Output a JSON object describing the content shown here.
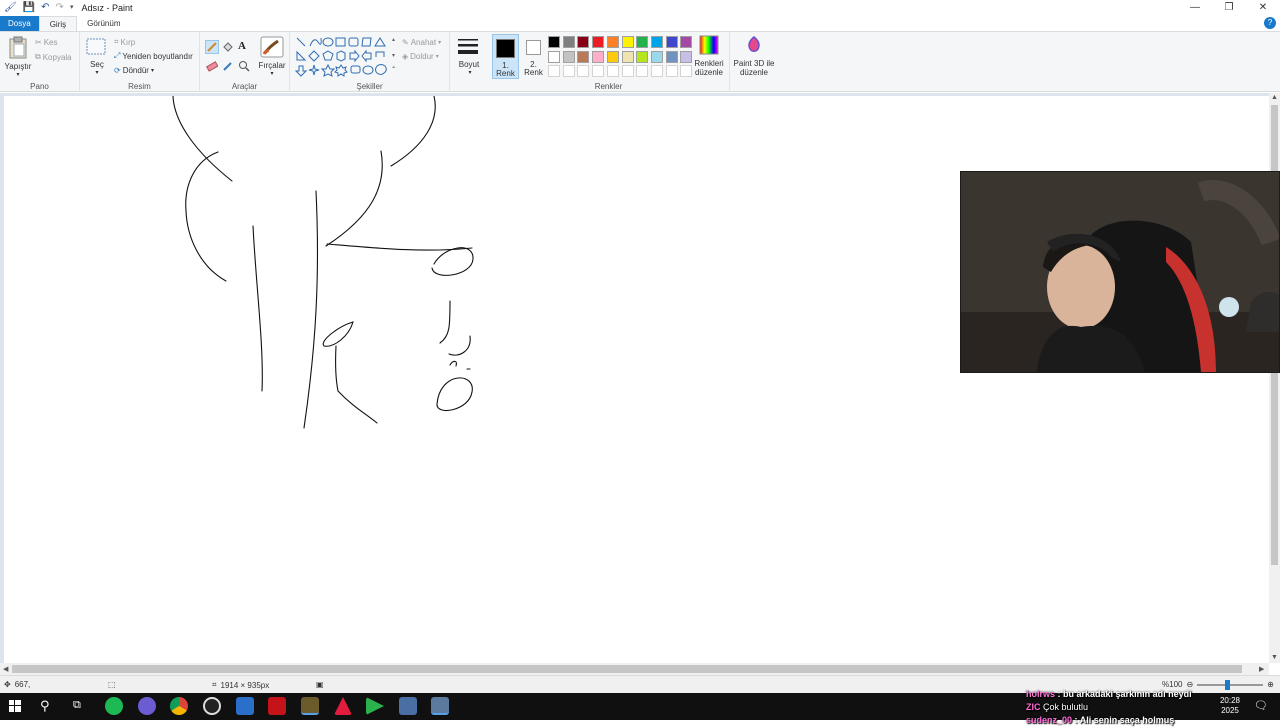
{
  "window": {
    "title": "Adsız - Paint"
  },
  "tabs": [
    {
      "label": "Dosya"
    },
    {
      "label": "Giriş"
    },
    {
      "label": "Görünüm"
    }
  ],
  "ribbon": {
    "clipboard": {
      "paste_label": "Yapıştır",
      "cut_label": "Kes",
      "copy_label": "Kopyala",
      "group_label": "Pano"
    },
    "image": {
      "select_label": "Seç",
      "crop_label": "Kırp",
      "resize_label": "Yeniden boyutlandır",
      "rotate_label": "Döndür",
      "group_label": "Resim"
    },
    "tools": {
      "group_label": "Araçlar",
      "brushes_label": "Fırçalar"
    },
    "shapes": {
      "outline_label": "Anahat",
      "fill_label": "Doldur",
      "group_label": "Şekiller"
    },
    "size": {
      "label": "Boyut"
    },
    "colors": {
      "color1_label_line1": "1.",
      "color1_label_line2": "Renk",
      "color2_label_line1": "2.",
      "color2_label_line2": "Renk",
      "color1_value": "#000000",
      "color2_value": "#ffffff",
      "edit_colors_line1": "Renkleri",
      "edit_colors_line2": "düzenle",
      "paint3d_line1": "Paint 3D ile",
      "paint3d_line2": "düzenle",
      "group_label": "Renkler",
      "palette_row1": [
        "#000000",
        "#7f7f7f",
        "#880015",
        "#ed1c24",
        "#ff7f27",
        "#fff200",
        "#22b14c",
        "#00a2e8",
        "#3f48cc",
        "#a349a4"
      ],
      "palette_row2": [
        "#ffffff",
        "#c3c3c3",
        "#b97a57",
        "#ffaec9",
        "#ffc90e",
        "#efe4b0",
        "#b5e61d",
        "#99d9ea",
        "#7092be",
        "#c8bfe7"
      ]
    }
  },
  "status": {
    "cursor_pos": "667,",
    "canvas_size": "1914 × 935px",
    "zoom": "%100"
  },
  "taskbar": {
    "time": "20:28",
    "date": "2025"
  },
  "chat": [
    {
      "user": "holrws",
      "message": ": bu arkadaki şarkının adı neydi"
    },
    {
      "user": "ZIC",
      "message": "Çok bulutlu"
    },
    {
      "user": "sudenz_00",
      "message": ": Ali senin saça holmuş"
    }
  ]
}
